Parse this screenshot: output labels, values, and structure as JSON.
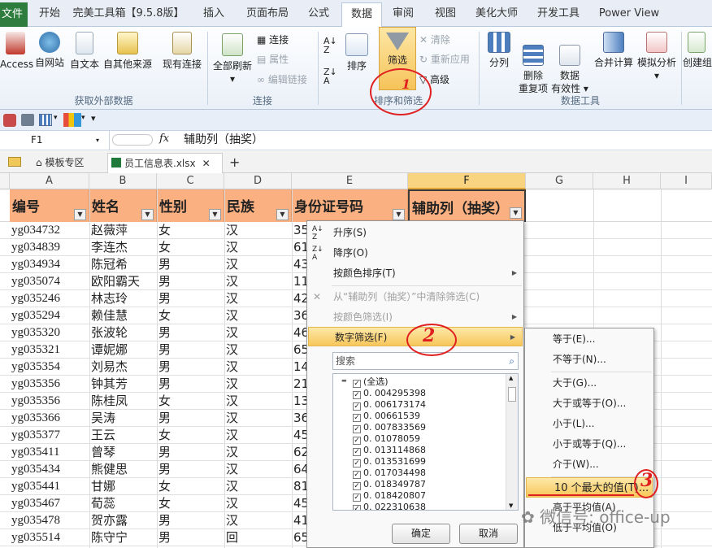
{
  "ribbon_tabs": {
    "file": "文件",
    "items": [
      "开始",
      "完美工具箱【9.5.8版】",
      "插入",
      "页面布局",
      "公式",
      "数据",
      "审阅",
      "视图",
      "美化大师",
      "开发工具",
      "Power View"
    ],
    "active": "数据"
  },
  "ribbon": {
    "get_external": {
      "access": "Access",
      "web": "自网站",
      "text": "自文本",
      "other": "自其他来源",
      "existing": "现有连接",
      "label": "获取外部数据"
    },
    "connections": {
      "refresh": "全部刷新",
      "connect": "连接",
      "props": "属性",
      "edit": "编辑链接",
      "label": "连接"
    },
    "sort_filter": {
      "sort": "排序",
      "filter": "筛选",
      "clear": "清除",
      "reapply": "重新应用",
      "advanced": "高级",
      "label": "排序和筛选"
    },
    "tools": {
      "split": "分列",
      "remove_dup": "删除\n重复项",
      "validation": "数据\n有效性",
      "consolidate": "合并计算",
      "whatif": "模拟分析",
      "create": "创建组",
      "label": "数据工具"
    }
  },
  "formula_bar": {
    "cell": "F1",
    "fx": "fx",
    "value": "辅助列（抽奖）"
  },
  "workbook_tabs": {
    "template": "模板专区",
    "file": "员工信息表.xlsx",
    "add": "+"
  },
  "columns": [
    "A",
    "B",
    "C",
    "D",
    "E",
    "F",
    "G",
    "H",
    "I"
  ],
  "selected_column": "F",
  "headers": [
    "编号",
    "姓名",
    "性别",
    "民族",
    "身份证号码",
    "辅助列（抽奖）"
  ],
  "rows": [
    [
      "yg034732",
      "赵薇萍",
      "女",
      "汉",
      "35"
    ],
    [
      "yg034839",
      "李连杰",
      "女",
      "汉",
      "61"
    ],
    [
      "yg034934",
      "陈冠希",
      "男",
      "汉",
      "43"
    ],
    [
      "yg035074",
      "欧阳霸天",
      "男",
      "汉",
      "11"
    ],
    [
      "yg035246",
      "林志玲",
      "男",
      "汉",
      "42"
    ],
    [
      "yg035294",
      "赖佳慧",
      "女",
      "汉",
      "36"
    ],
    [
      "yg035320",
      "张波轮",
      "男",
      "汉",
      "46"
    ],
    [
      "yg035321",
      "谭妮娜",
      "男",
      "汉",
      "65"
    ],
    [
      "yg035354",
      "刘易杰",
      "男",
      "汉",
      "14"
    ],
    [
      "yg035356",
      "钟其芳",
      "男",
      "汉",
      "21"
    ],
    [
      "yg035356",
      "陈桂凤",
      "女",
      "汉",
      "13"
    ],
    [
      "yg035366",
      "吴涛",
      "男",
      "汉",
      "36"
    ],
    [
      "yg035377",
      "王云",
      "女",
      "汉",
      "45"
    ],
    [
      "yg035411",
      "曾琴",
      "男",
      "汉",
      "62"
    ],
    [
      "yg035434",
      "熊健思",
      "男",
      "汉",
      "64"
    ],
    [
      "yg035441",
      "甘娜",
      "女",
      "汉",
      "81"
    ],
    [
      "yg035467",
      "荀蕊",
      "女",
      "汉",
      "45"
    ],
    [
      "yg035478",
      "贺亦露",
      "男",
      "汉",
      "41"
    ],
    [
      "yg035514",
      "陈守宁",
      "男",
      "回",
      "65"
    ]
  ],
  "filter_menu": {
    "sort_asc": "升序(S)",
    "sort_desc": "降序(O)",
    "sort_color": "按颜色排序(T)",
    "clear": "从“辅助列（抽奖）”中清除筛选(C)",
    "filter_color": "按颜色筛选(I)",
    "number_filter": "数字筛选(F)",
    "search_placeholder": "搜索",
    "values": [
      "(全选)",
      "0. 004295398",
      "0. 006173174",
      "0. 00661539",
      "0. 007833569",
      "0. 01078059",
      "0. 013114868",
      "0. 013531699",
      "0. 017034498",
      "0. 018349787",
      "0. 018420807",
      "0. 022310638"
    ],
    "ok": "确定",
    "cancel": "取消"
  },
  "number_submenu": [
    "等于(E)...",
    "不等于(N)...",
    "大于(G)...",
    "大于或等于(O)...",
    "小于(L)...",
    "小于或等于(Q)...",
    "介于(W)...",
    "10 个最大的值(T)...",
    "高于平均值(A)",
    "低于平均值(O)"
  ],
  "annotations": [
    "1",
    "2",
    "3"
  ],
  "watermark": "微信号: office-up",
  "colors": {
    "header_fill": "#fab080",
    "highlight": "#f7c65a",
    "annotation": "#e02020",
    "file_tab": "#2f7c3f"
  }
}
